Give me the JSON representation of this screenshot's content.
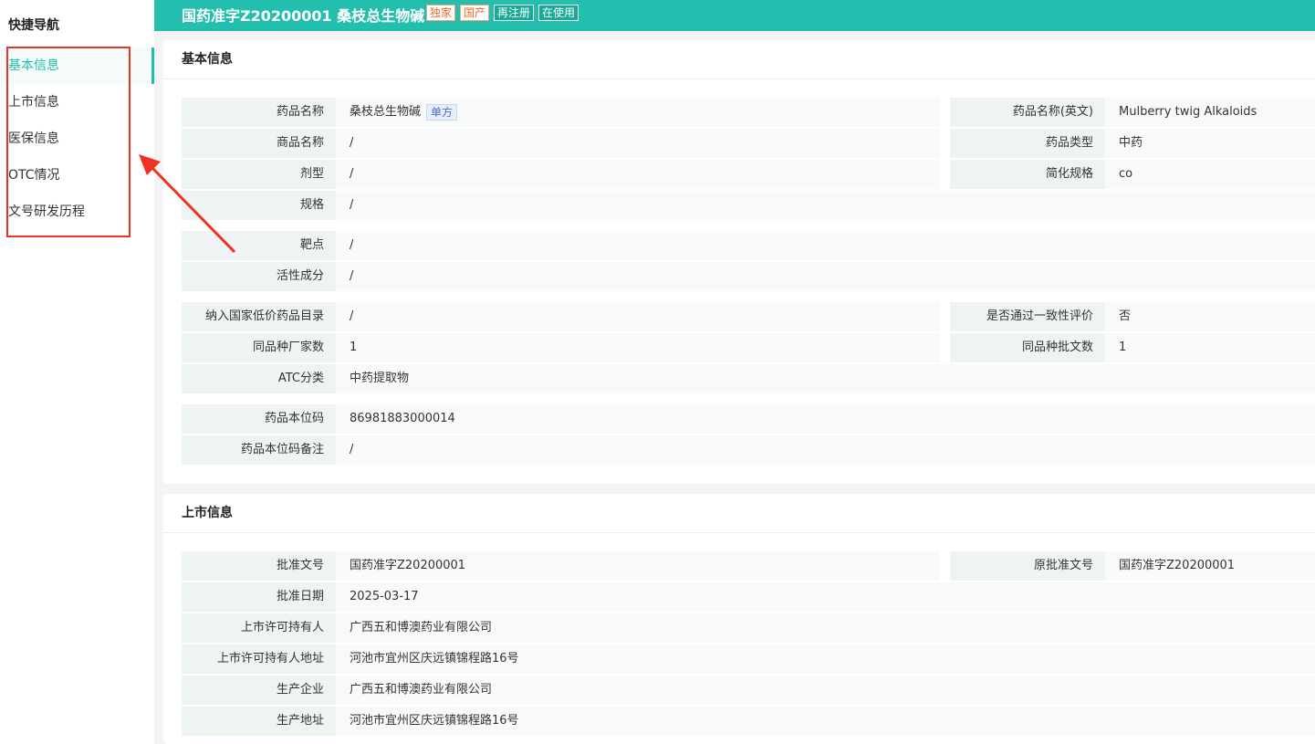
{
  "sidebar": {
    "title": "快捷导航",
    "items": [
      {
        "label": "基本信息",
        "active": true
      },
      {
        "label": "上市信息"
      },
      {
        "label": "医保信息"
      },
      {
        "label": "OTC情况"
      },
      {
        "label": "文号研发历程"
      }
    ]
  },
  "header": {
    "title": "国药准字Z20200001  桑枝总生物碱",
    "badges": [
      "独家",
      "国产",
      "再注册",
      "在使用"
    ]
  },
  "basic": {
    "title": "基本信息",
    "drug_name_label": "药品名称",
    "drug_name_value": "桑枝总生物碱",
    "drug_name_tag": "单方",
    "drug_name_en_label": "药品名称(英文)",
    "drug_name_en_value": "Mulberry twig Alkaloids",
    "trade_name_label": "商品名称",
    "trade_name_value": "/",
    "drug_type_label": "药品类型",
    "drug_type_value": "中药",
    "dosage_label": "剂型",
    "dosage_value": "/",
    "simple_spec_label": "简化规格",
    "simple_spec_value": "co",
    "spec_label": "规格",
    "spec_value": "/",
    "target_label": "靶点",
    "target_value": "/",
    "active_label": "活性成分",
    "active_value": "/",
    "lowprice_label": "纳入国家低价药品目录",
    "lowprice_value": "/",
    "consistency_label": "是否通过一致性评价",
    "consistency_value": "否",
    "mfr_count_label": "同品种厂家数",
    "mfr_count_value": "1",
    "approval_count_label": "同品种批文数",
    "approval_count_value": "1",
    "atc_label": "ATC分类",
    "atc_value": "中药提取物",
    "code_label": "药品本位码",
    "code_value": "86981883000014",
    "code_note_label": "药品本位码备注",
    "code_note_value": "/"
  },
  "market": {
    "title": "上市信息",
    "approval_no_label": "批准文号",
    "approval_no_value": "国药准字Z20200001",
    "orig_approval_label": "原批准文号",
    "orig_approval_value": "国药准字Z20200001",
    "approval_date_label": "批准日期",
    "approval_date_value": "2025-03-17",
    "holder_label": "上市许可持有人",
    "holder_value": "广西五和博澳药业有限公司",
    "holder_addr_label": "上市许可持有人地址",
    "holder_addr_value": "河池市宜州区庆远镇锦程路16号",
    "producer_label": "生产企业",
    "producer_value": "广西五和博澳药业有限公司",
    "producer_addr_label": "生产地址",
    "producer_addr_value": "河池市宜州区庆远镇锦程路16号"
  }
}
